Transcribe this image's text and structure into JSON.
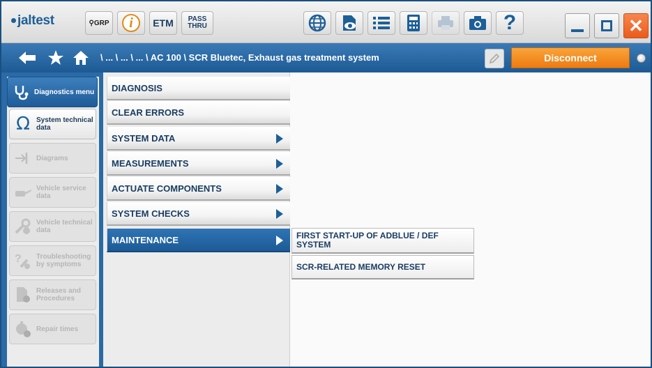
{
  "toolbar": {
    "logo_text": "jaltest",
    "grp_label": "GRP",
    "info_label": "i",
    "etm_label": "ETM",
    "pass_line1": "PASS",
    "pass_line2": "THRU",
    "help_label": "?",
    "close_label": "✕"
  },
  "navbar": {
    "breadcrumb": "\\ ... \\ ... \\ ... \\ AC 100 \\ SCR Bluetec, Exhaust gas treatment system",
    "disconnect_label": "Disconnect"
  },
  "sidebar": {
    "items": [
      {
        "label": "Diagnostics menu",
        "icon": "stethoscope-icon",
        "state": "active"
      },
      {
        "label": "System technical data",
        "icon": "omega-icon",
        "state": "enabled"
      },
      {
        "label": "Diagrams",
        "icon": "diagram-icon",
        "state": "disabled"
      },
      {
        "label": "Vehicle service data",
        "icon": "oil-can-icon",
        "state": "disabled"
      },
      {
        "label": "Vehicle technical data",
        "icon": "wrench-gear-icon",
        "state": "disabled"
      },
      {
        "label": "Troubleshooting by symptoms",
        "icon": "troubleshoot-icon",
        "state": "disabled"
      },
      {
        "label": "Releases and Procedures",
        "icon": "document-gear-icon",
        "state": "disabled"
      },
      {
        "label": "Repair times",
        "icon": "stopwatch-gear-icon",
        "state": "disabled"
      }
    ]
  },
  "menu": {
    "items": [
      {
        "label": "DIAGNOSIS",
        "has_submenu": false,
        "active": false
      },
      {
        "label": "CLEAR ERRORS",
        "has_submenu": false,
        "active": false
      },
      {
        "label": "SYSTEM DATA",
        "has_submenu": true,
        "active": false
      },
      {
        "label": "MEASUREMENTS",
        "has_submenu": true,
        "active": false
      },
      {
        "label": "ACTUATE COMPONENTS",
        "has_submenu": true,
        "active": false
      },
      {
        "label": "SYSTEM CHECKS",
        "has_submenu": true,
        "active": false
      },
      {
        "label": "MAINTENANCE",
        "has_submenu": true,
        "active": true
      }
    ]
  },
  "submenu": {
    "items": [
      {
        "label": "FIRST START-UP OF ADBLUE / DEF SYSTEM"
      },
      {
        "label": "SCR-RELATED MEMORY RESET"
      }
    ]
  },
  "colors": {
    "brand_blue": "#1d5f97",
    "accent_orange": "#ee7b10",
    "close_red": "#ec5a1c"
  }
}
